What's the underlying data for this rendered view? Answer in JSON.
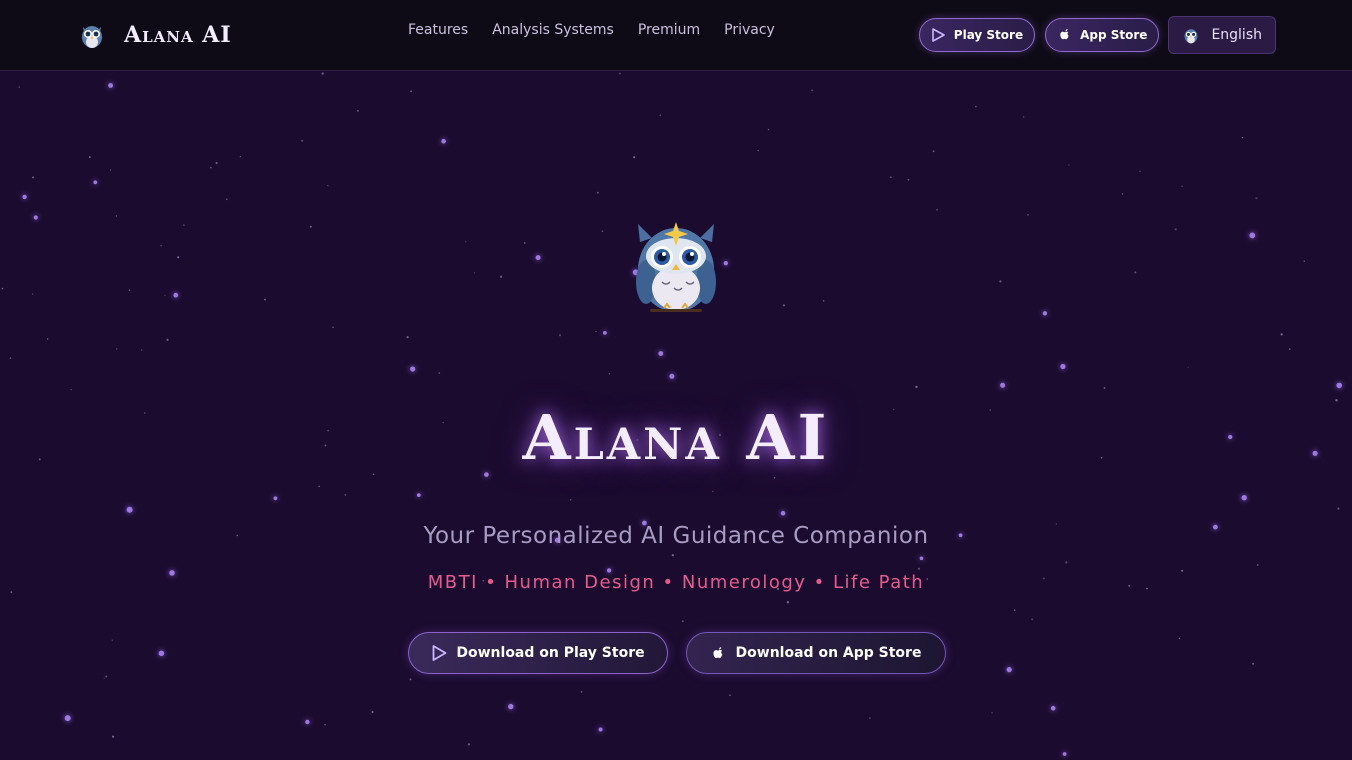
{
  "brand": {
    "name": "Alana AI"
  },
  "nav": {
    "links": [
      "Features",
      "Analysis Systems",
      "Premium",
      "Privacy"
    ],
    "play_store": "Play Store",
    "app_store": "App Store",
    "language": "English"
  },
  "hero": {
    "title": "Alana AI",
    "subtitle": "Your Personalized AI Guidance Companion",
    "tags": "MBTI • Human Design • Numerology • Life Path",
    "cta_play": "Download on Play Store",
    "cta_app": "Download on App Store"
  },
  "colors": {
    "background": "#1b0b2e",
    "navbar": "#0f0b16",
    "accent_pink": "#e85a8e",
    "accent_purple": "#8f6ad0"
  },
  "icons": [
    "owl-logo-icon",
    "play-store-icon",
    "apple-icon"
  ]
}
